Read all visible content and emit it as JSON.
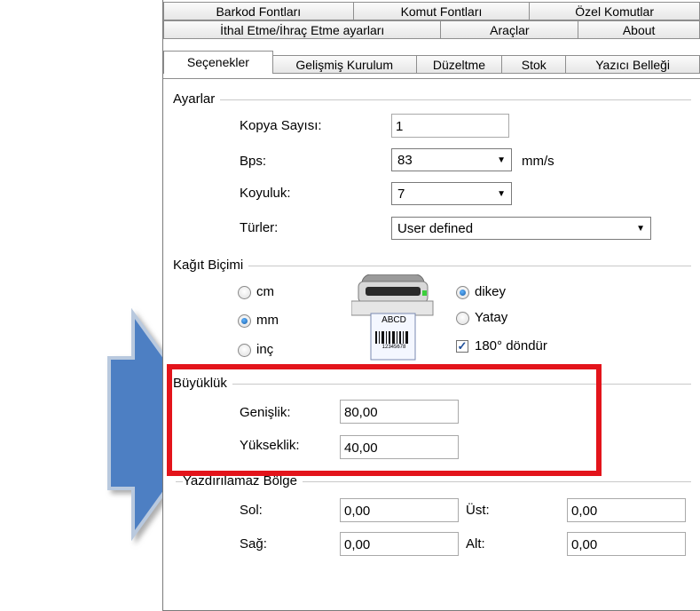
{
  "tabs": {
    "row1": [
      "Barkod Fontları",
      "Komut Fontları",
      "Özel Komutlar"
    ],
    "row2": [
      "İthal Etme/İhraç Etme ayarları",
      "Araçlar",
      "About"
    ],
    "row3": [
      "Seçenekler",
      "Gelişmiş Kurulum",
      "Düzeltme",
      "Stok",
      "Yazıcı Belleği"
    ]
  },
  "ayarlar": {
    "title": "Ayarlar",
    "kopya_label": "Kopya Sayısı:",
    "kopya_value": "1",
    "bps_label": "Bps:",
    "bps_value": "83",
    "bps_unit": "mm/s",
    "koyuluk_label": "Koyuluk:",
    "koyuluk_value": "7",
    "turler_label": "Türler:",
    "turler_value": "User defined"
  },
  "kagit": {
    "title": "Kağıt Biçimi",
    "units": [
      "cm",
      "mm",
      "inç"
    ],
    "selected_unit": "mm",
    "orientation": [
      "dikey",
      "Yatay"
    ],
    "selected_orientation": "dikey",
    "rotate_label": "180° döndür",
    "rotate_checked": true,
    "printer_label_text": "ABCD",
    "printer_label_number": "12345678"
  },
  "buyukluk": {
    "title": "Büyüklük",
    "genislik_label": "Genişlik:",
    "genislik_value": "80,00",
    "yukseklik_label": "Yükseklik:",
    "yukseklik_value": "40,00"
  },
  "yazdirilamaz": {
    "title": "Yazdırılamaz Bölge",
    "sol_label": "Sol:",
    "sol_value": "0,00",
    "ust_label": "Üst:",
    "ust_value": "0,00",
    "sag_label": "Sağ:",
    "sag_value": "0,00",
    "alt_label": "Alt:",
    "alt_value": "0,00"
  },
  "colors": {
    "arrow": "#4e7fc3",
    "highlight": "#e3141b"
  }
}
